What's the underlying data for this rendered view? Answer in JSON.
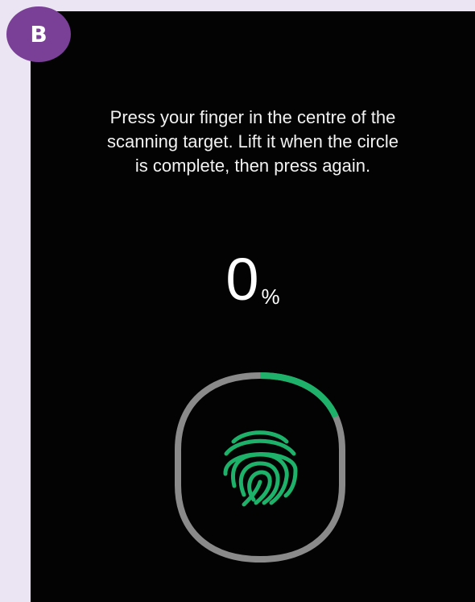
{
  "badge": {
    "label": "B"
  },
  "instruction": {
    "line1": "Press your finger in the centre of the",
    "line2": "scanning target. Lift it when the circle",
    "line3": "is complete, then press again."
  },
  "progress": {
    "value": "0",
    "unit": "%",
    "ring_fraction": 0.16
  },
  "colors": {
    "background": "#ebe4f3",
    "screen": "#030303",
    "badge": "#7a3f97",
    "ring_track": "#8a8a8a",
    "ring_progress": "#1db169",
    "fingerprint": "#1db169"
  },
  "icons": {
    "fingerprint": "fingerprint-icon"
  }
}
